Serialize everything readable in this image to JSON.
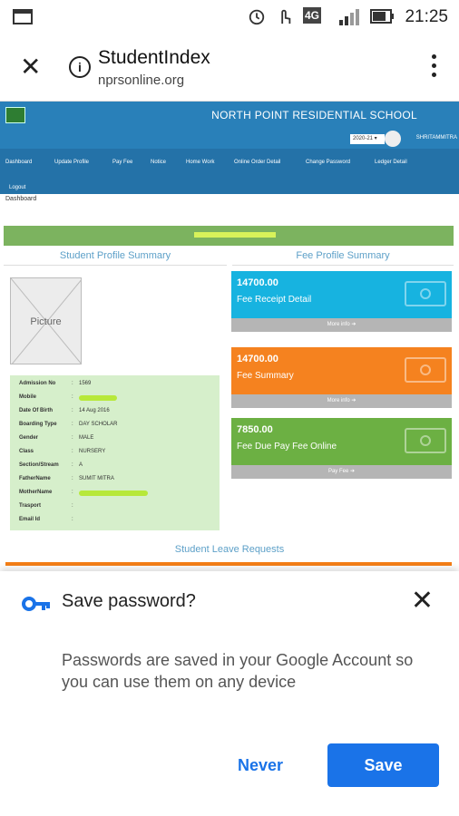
{
  "status_bar": {
    "time": "21:25",
    "network": "4G"
  },
  "browser": {
    "title": "StudentIndex",
    "url": "nprsonline.org"
  },
  "site": {
    "school_name": "NORTH POINT RESIDENTIAL SCHOOL",
    "session": "2020-21 ▾",
    "username": "SHRITAMMITRA",
    "nav": [
      "Dashboard",
      "Update Profile",
      "Pay Fee",
      "Notice",
      "Home Work",
      "Online Order Detail",
      "Change Password",
      "Ledger Detail"
    ],
    "logout": "Logout",
    "breadcrumb": "Dashboard",
    "student_profile_title": "Student Profile Summary",
    "fee_profile_title": "Fee Profile Summary",
    "picture_label": "Picture",
    "profile_rows": [
      {
        "key": "Admission No",
        "value": "1569"
      },
      {
        "key": "Mobile",
        "value": ""
      },
      {
        "key": "Date Of Birth",
        "value": "14 Aug 2016"
      },
      {
        "key": "Boarding Type",
        "value": "DAY SCHOLAR"
      },
      {
        "key": "Gender",
        "value": "MALE"
      },
      {
        "key": "Class",
        "value": "NURSERY"
      },
      {
        "key": "Section/Stream",
        "value": "A"
      },
      {
        "key": "FatherName",
        "value": "SUMIT MITRA"
      },
      {
        "key": "MotherName",
        "value": ""
      },
      {
        "key": "Trasport",
        "value": ""
      },
      {
        "key": "Email Id",
        "value": ""
      }
    ],
    "fee_cards": [
      {
        "amount": "14700.00",
        "label": "Fee Receipt Detail",
        "footer": "More info ➔",
        "color": "#17b3e0"
      },
      {
        "amount": "14700.00",
        "label": "Fee Summary",
        "footer": "More info ➔",
        "color": "#f5821f"
      },
      {
        "amount": "7850.00",
        "label": "Fee Due Pay Fee Online",
        "footer": "Pay Fee ➔",
        "color": "#6cb043"
      }
    ],
    "leave_title": "Student Leave Requests"
  },
  "save_password": {
    "title": "Save password?",
    "body": "Passwords are saved in your Google Account so you can use them on any device",
    "never_label": "Never",
    "save_label": "Save",
    "accent": "#1a73e8"
  }
}
